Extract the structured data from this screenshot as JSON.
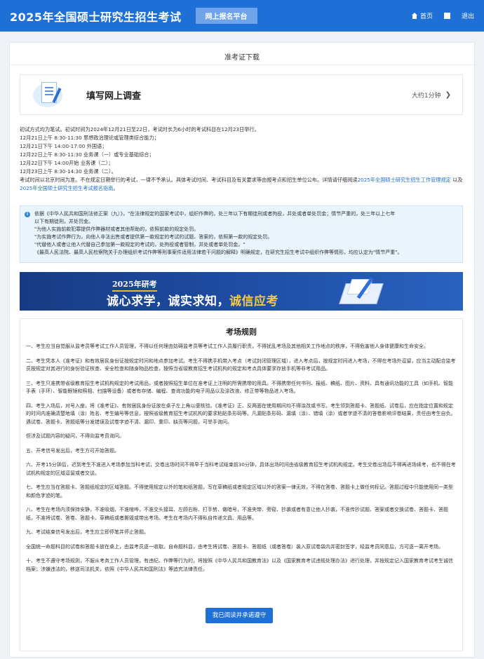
{
  "header": {
    "brand": "2025年全国硕士研究生招生考试",
    "platform_tag": "网上报名平台",
    "home_label": "首页",
    "logout_label": "退出"
  },
  "panel": {
    "title": "准考证下载"
  },
  "survey": {
    "title": "填写网上调查",
    "time": "大约1分钟"
  },
  "schedule": {
    "lines": [
      "初试方式均为笔试。初试时间为2024年12月21日至22日，考试时长为6小时的考试科目在12月23日举行。",
      "12月21日上午 8:30-11:30 思想政治理论或管理类综合能力；",
      "12月21日下午 14:00-17:00 外国语；",
      "12月22日上午 8:30-11:30 业务课（一）或专业基础综合；",
      "12月22日下午 14:00开始 业务课（二）；",
      "12月23日上午 8:30-14:30 业务课（二）。"
    ],
    "para_before": "考试时间以北京时间为准。不在规定日期举行的考试，一律不予承认。具体考试时间、考试科目及有关要求等由报考点和招生单位公布。详情请仔细阅读",
    "link1": "2025年全国硕士研究生招生工作管理规定",
    "para_mid": "以及",
    "link2": "2025年全国硕士研究生招生考试报名指南",
    "para_end": "。"
  },
  "notice": {
    "lines": [
      "依据《中华人民共和国刑法修正案（九）》，\"在法律规定的国家考试中，组织作弊的，处三年以下有期徒刑或者拘役，并处或者单处罚金；情节严重的，处三年以上七年",
      "以下有期徒刑，并处罚金。",
      "\"为他人实施前款犯罪提供作弊器材或者其他帮助的，依照前款的规定处罚。",
      "\"为实施考试作弊行为，向他人非法出售或者提供第一款规定的考试的试题、答案的，依照第一款的规定处罚。",
      "\"代替他人或者让他人代替自己参加第一款规定的考试的，处拘役或者管制，并处或者单处罚金。\"",
      "《最高人民法院、最高人民检察院关于办理组织考试作弊等刑事案件适用法律若干问题的解释》明确规定，在研究生招生考试中组织作弊等情形，均应认定为\"情节严重\"。"
    ]
  },
  "banner": {
    "year": "2025年研考",
    "slogan_main": "诚心求学，诚实求知，",
    "slogan_highlight": "诚信应考"
  },
  "rules": {
    "title": "考场规则",
    "items": [
      "一、考生应当自觉服从监考员等考试工作人员管理，不得以任何理由妨碍监考员等考试工作人员履行职责，不得扰乱考场及其他相关工作地点的秩序，不得危害他人身体健康和生命安全。",
      "二、考生凭本人《准考证》和有效居民身份证按规定时间和地点参加考试。考生不得携手机带入考点（考试封闭管理区域），进入考点后，按规定时间进入考场，不得在考场外逗留，应当主动配合监考员按规定对其进行的身份验证核查、安全检查和随身物品检查，按照当省级教育招生考试机构的规定和考点具体要求存放手机等非考试用品。",
      "三、考生只准携带省级教育招生考试机构规定的考试用品，或者按照招生单位在准考证上注明的所需携带的用具。不得携带任何书刊、报纸、稿纸、图片、资料、具有通讯功能的工具（如手机、智能手表（手环）、智能眼镜和照相、扫描等设备）或者有存储、编程、查询功能的电子用品以及涂改液、修正带等物品进入考场。",
      "四、考生入场后，对号入座，将《准考证》、有效居民身份证放在桌子左上角以便核验。《准考证》正、反两面在使用期间均不得涂改或书写。考生领到答题卡、答题纸、试卷后，应在指定位置和规定的时间内准确清楚地填（涂）姓名、考生编号等信息，按照省级教育招生考试机构的要求粘贴条形码等。凡漏贴条形码、漏填（涂）、错填（涂）或者字迹不清的答卷影响评卷结果，责任由考生自负。遇试卷、答题卡、答题纸等分发错误及试卷字迹不清、漏印、重印、缺页等问题，可举手询问。",
      "但涉及试题内容的疑问，不得向监考员询问。",
      "五、开考信号发出后，考生方可开始答题。",
      "六、开考15分钟后，迟到考生不准进入考场参加当科考试，交卷出场时间不得早于当科考试结束前30分钟，具体出场时间由省级教育招生考试机构规定。考生交卷出场后不得再进场续考，也不得在考试机构规定的区域逗留或者交谈。",
      "七、考生应当在答题卡、答题纸规定的区域答题。不得使用规定以外的笔和纸答题，写在草稿纸或者规定区域以外的答案一律无效，不得在答卷、答题卡上做任何标记。答题过程中只能使用同一类型和颜色字迹的笔。",
      "八、考生在考场内须保持安静，不准吸烟，不准喧哗，不准交头接耳、左顾右盼、打手势、做暗号，不准夹带、旁窥、抄袭或者有意让他人抄袭，不准传抄试题、答案或者交换试卷、答题卡、答题纸，不准将试卷、答卷、答题卡、草稿纸或者撕毁或带出考场。考生在考场内不得私自传递文具、用品等。",
      "九、考试结束信号发出后，考生应立即停笔并停止答题。",
      "全国统一命题科目的试卷和答题卡放在桌上，由监考员逐一收取。自命题科目，由考生将试卷、答题卡、答题纸（或者答卷）装入原试卷袋内并密封签字，经监考员同意后，方可逐一离开考场。",
      "十、考生不遵守考场规则，不服从考务工作人员管理，有违纪、作弊等行为的，将按照《中华人民共和国教育法》以及《国家教育考试违规处理办法》进行处理，并按规定记入国家教育考试考生诚信档案；涉嫌违法的，移送司法机关，依照《中华人民共和国刑法》等追究法律责任。"
    ]
  },
  "actions": {
    "confirm_label": "我已阅读并承诺遵守"
  }
}
